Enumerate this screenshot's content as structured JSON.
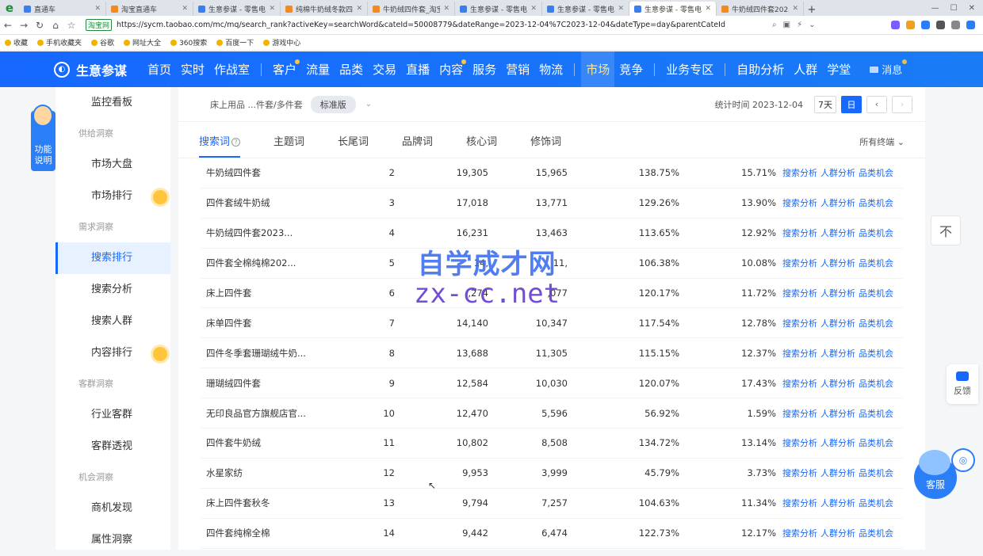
{
  "browser": {
    "tabs": [
      {
        "label": "直通车",
        "favicon": "blue",
        "active": false
      },
      {
        "label": "淘宝直通车",
        "favicon": "orange",
        "active": false
      },
      {
        "label": "生意参谋 - 零售电商",
        "favicon": "blue",
        "active": false
      },
      {
        "label": "纯棉牛奶绒冬款四件",
        "favicon": "orange",
        "active": false
      },
      {
        "label": "牛奶绒四件套_淘宝",
        "favicon": "orange",
        "active": false
      },
      {
        "label": "生意参谋 - 零售电商",
        "favicon": "blue",
        "active": false
      },
      {
        "label": "生意参谋 - 零售电商",
        "favicon": "blue",
        "active": false
      },
      {
        "label": "生意参谋 - 零售电商",
        "favicon": "blue",
        "active": true
      },
      {
        "label": "牛奶绒四件套2023年",
        "favicon": "orange",
        "active": false
      }
    ],
    "new_tab": "+",
    "secure_label": "淘宝网",
    "url": "https://sycm.taobao.com/mc/mq/search_rank?activeKey=searchWord&cateId=50008779&dateRange=2023-12-04%7C2023-12-04&dateType=day&parentCateId",
    "bookmarks": [
      "收藏",
      "手机收藏夹",
      "谷歌",
      "网址大全",
      "360搜索",
      "百度一下",
      "游戏中心"
    ]
  },
  "header": {
    "brand": "生意参谋",
    "nav": [
      {
        "label": "首页",
        "dot": false,
        "active": false
      },
      {
        "label": "实时",
        "dot": false,
        "active": false
      },
      {
        "label": "作战室",
        "dot": false,
        "active": false
      },
      {
        "label": "客户",
        "dot": true,
        "active": false
      },
      {
        "label": "流量",
        "dot": false,
        "active": false
      },
      {
        "label": "品类",
        "dot": false,
        "active": false
      },
      {
        "label": "交易",
        "dot": false,
        "active": false
      },
      {
        "label": "直播",
        "dot": false,
        "active": false
      },
      {
        "label": "内容",
        "dot": true,
        "active": false
      },
      {
        "label": "服务",
        "dot": false,
        "active": false
      },
      {
        "label": "营销",
        "dot": false,
        "active": false
      },
      {
        "label": "物流",
        "dot": false,
        "active": false
      },
      {
        "label": "市场",
        "dot": false,
        "active": true
      },
      {
        "label": "竞争",
        "dot": false,
        "active": false
      },
      {
        "label": "业务专区",
        "dot": false,
        "active": false
      },
      {
        "label": "自助分析",
        "dot": false,
        "active": false
      },
      {
        "label": "人群",
        "dot": false,
        "active": false
      },
      {
        "label": "学堂",
        "dot": false,
        "active": false
      }
    ],
    "message": "消息"
  },
  "help_badge": {
    "label_line1": "功能",
    "label_line2": "说明"
  },
  "sidebar": {
    "items": [
      {
        "type": "item",
        "label": "监控看板"
      },
      {
        "type": "group",
        "label": "供给洞察"
      },
      {
        "type": "item",
        "label": "市场大盘"
      },
      {
        "type": "item",
        "label": "市场排行",
        "hot": true
      },
      {
        "type": "group",
        "label": "需求洞察"
      },
      {
        "type": "item",
        "label": "搜索排行",
        "active": true
      },
      {
        "type": "item",
        "label": "搜索分析"
      },
      {
        "type": "item",
        "label": "搜索人群"
      },
      {
        "type": "item",
        "label": "内容排行",
        "hot": true
      },
      {
        "type": "group",
        "label": "客群洞察"
      },
      {
        "type": "item",
        "label": "行业客群"
      },
      {
        "type": "item",
        "label": "客群透视"
      },
      {
        "type": "group",
        "label": "机会洞察"
      },
      {
        "type": "item",
        "label": "商机发现"
      },
      {
        "type": "item",
        "label": "属性洞察"
      }
    ]
  },
  "filter": {
    "category": "床上用品 ...件套/多件套",
    "version": "标准版",
    "stat_time": "统计时间 2023-12-04",
    "btn_7d": "7天",
    "btn_day": "日",
    "prev": "‹",
    "next": "›"
  },
  "tabs": {
    "items": [
      "搜索词",
      "主题词",
      "长尾词",
      "品牌词",
      "核心词",
      "修饰词"
    ],
    "active_index": 0,
    "help_mark": "?",
    "terminal": "所有终端"
  },
  "table": {
    "ops": [
      "搜索分析",
      "人群分析",
      "品类机会"
    ],
    "rows": [
      {
        "word": "牛奶绒四件套",
        "rank": "2",
        "a": "19,305",
        "b": "15,965",
        "c": "138.75%",
        "d": "15.71%"
      },
      {
        "word": "四件套绒牛奶绒",
        "rank": "3",
        "a": "17,018",
        "b": "13,771",
        "c": "129.26%",
        "d": "13.90%"
      },
      {
        "word": "牛奶绒四件套2023...",
        "rank": "4",
        "a": "16,231",
        "b": "13,463",
        "c": "113.65%",
        "d": "12.92%"
      },
      {
        "word": "四件套全棉纯棉202...",
        "rank": "5",
        "a": "14,",
        "b": "11,",
        "c": "106.38%",
        "d": "10.08%"
      },
      {
        "word": "床上四件套",
        "rank": "6",
        "a": ",274",
        "b": ",077",
        "c": "120.17%",
        "d": "11.72%"
      },
      {
        "word": "床单四件套",
        "rank": "7",
        "a": "14,140",
        "b": "10,347",
        "c": "117.54%",
        "d": "12.78%"
      },
      {
        "word": "四件冬季套珊瑚绒牛奶...",
        "rank": "8",
        "a": "13,688",
        "b": "11,305",
        "c": "115.15%",
        "d": "12.37%"
      },
      {
        "word": "珊瑚绒四件套",
        "rank": "9",
        "a": "12,584",
        "b": "10,030",
        "c": "120.07%",
        "d": "17.43%"
      },
      {
        "word": "无印良品官方旗舰店官...",
        "rank": "10",
        "a": "12,470",
        "b": "5,596",
        "c": "56.92%",
        "d": "1.59%"
      },
      {
        "word": "四件套牛奶绒",
        "rank": "11",
        "a": "10,802",
        "b": "8,508",
        "c": "134.72%",
        "d": "13.14%"
      },
      {
        "word": "水星家纺",
        "rank": "12",
        "a": "9,953",
        "b": "3,999",
        "c": "45.79%",
        "d": "3.73%"
      },
      {
        "word": "床上四件套秋冬",
        "rank": "13",
        "a": "9,794",
        "b": "7,257",
        "c": "104.63%",
        "d": "11.34%"
      },
      {
        "word": "四件套纯棉全棉",
        "rank": "14",
        "a": "9,442",
        "b": "6,474",
        "c": "122.73%",
        "d": "12.17%"
      }
    ]
  },
  "watermark": {
    "line1": "自学成才网",
    "line2": "zx-cc.net"
  },
  "floaters": {
    "top": "不",
    "feedback": "反馈",
    "service": "客服"
  },
  "colors": {
    "brand": "#1668ff",
    "hot": "#ffc53d",
    "link": "#1668ff"
  }
}
